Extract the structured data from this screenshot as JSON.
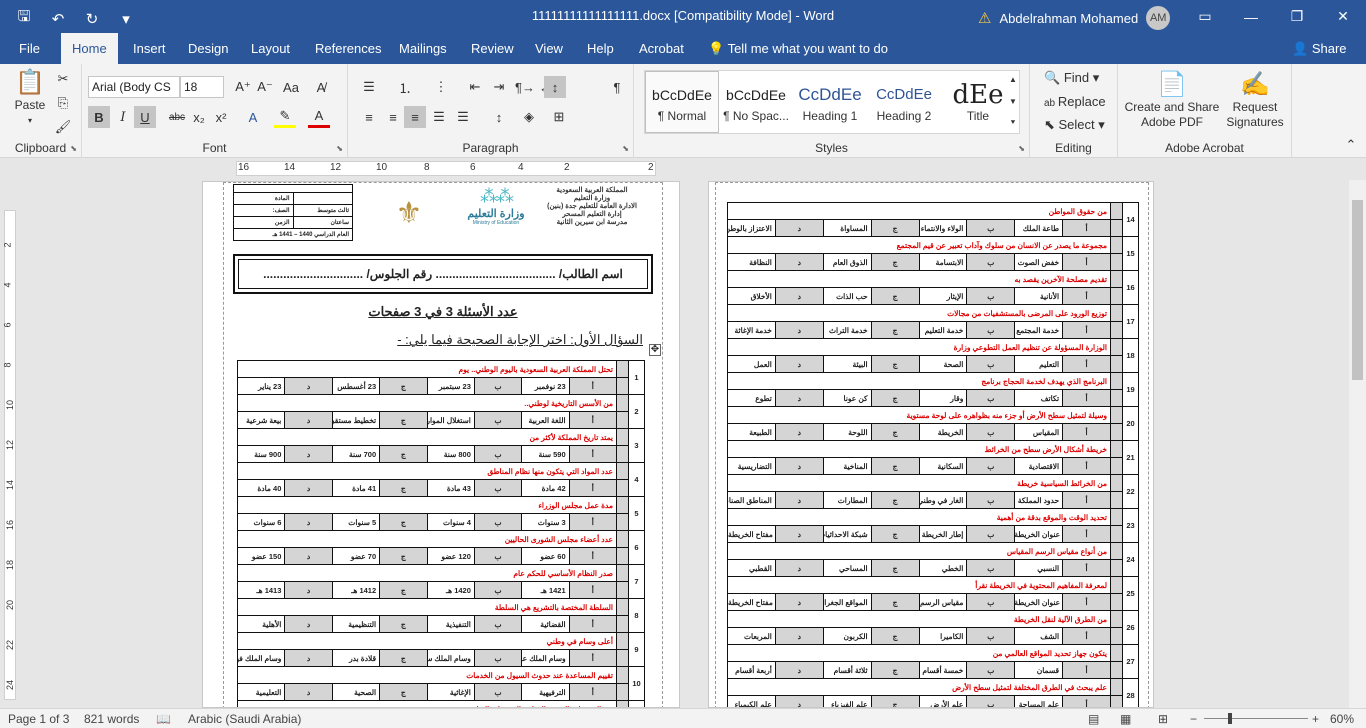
{
  "app": {
    "doc_title": "11111111111111111.docx [Compatibility Mode]  -  Word",
    "user_name": "Abdelrahman Mohamed",
    "user_initials": "AM"
  },
  "tabs": [
    "File",
    "Home",
    "Insert",
    "Design",
    "Layout",
    "References",
    "Mailings",
    "Review",
    "View",
    "Help",
    "Acrobat"
  ],
  "tell_me": "Tell me what you want to do",
  "share": "Share",
  "clipboard": {
    "paste": "Paste",
    "label": "Clipboard"
  },
  "font": {
    "name": "Arial (Body CS",
    "size": "18",
    "label": "Font"
  },
  "paragraph": {
    "label": "Paragraph"
  },
  "styles": {
    "label": "Styles",
    "items": [
      {
        "preview": "bCcDdEe",
        "name": "¶ Normal"
      },
      {
        "preview": "bCcDdEe",
        "name": "¶ No Spac..."
      },
      {
        "preview": "CcDdEe",
        "name": "Heading 1"
      },
      {
        "preview": "CcDdEe",
        "name": "Heading 2"
      },
      {
        "preview": "dEe",
        "name": "Title"
      }
    ]
  },
  "editing": {
    "find": "Find",
    "replace": "Replace",
    "select": "Select",
    "label": "Editing"
  },
  "acrobat": {
    "create": "Create and Share Adobe PDF",
    "request": "Request Signatures",
    "label": "Adobe Acrobat"
  },
  "ruler": [
    "16",
    "14",
    "12",
    "10",
    "8",
    "6",
    "4",
    "2",
    "2"
  ],
  "vruler": [
    "2",
    "4",
    "6",
    "8",
    "10",
    "12",
    "14",
    "16",
    "18",
    "20",
    "22",
    "24"
  ],
  "status": {
    "page": "Page 1 of 3",
    "words": "821 words",
    "language": "Arabic (Saudi Arabia)",
    "zoom": "60%"
  },
  "left_page": {
    "header_right": [
      "المملكة العربية السعودية",
      "وزارة التعليم",
      "الادارة العامة للتعليم جدة (بنين)",
      "إدارة التعليم المسحر",
      "مدرسة ابن سيرين الثانية"
    ],
    "ministry": "وزارة التعليم",
    "ministry_en": "Ministry of Education",
    "info": [
      [
        "المادة",
        ""
      ],
      [
        "الصف:",
        "ثالث متوسط"
      ],
      [
        "الزمن",
        "ساعتان"
      ],
      [
        "العام الدراسي 1440 – 1441 هـ",
        ""
      ]
    ],
    "student_line": "اسم الطالب/ ....................................  رقم الجلوس/ ..............................",
    "count_line": "عدد الأسئلة 3 في 3 صفحات",
    "q1_title": "السؤال الأول: اختر الإجابة الصحيحة فيما يلي: -",
    "letters": [
      "أ",
      "ب",
      "ج",
      "د"
    ],
    "questions": [
      {
        "n": "1",
        "q": "تحتل المملكة العربية السعودية باليوم الوطني.. يوم",
        "o": [
          "23 نوفمبر",
          "23 سبتمبر",
          "23 أغسطس",
          "23 يناير"
        ]
      },
      {
        "n": "2",
        "q": "من الأسس التاريخية لوطني..",
        "o": [
          "اللغة العربية",
          "استغلال الموارد",
          "تخطيط مستقبلي",
          "بيعة شرعية"
        ]
      },
      {
        "n": "3",
        "q": "يمتد تاريخ المملكة لأكثر من",
        "o": [
          "590 سنة",
          "800 سنة",
          "700 سنة",
          "900 سنة"
        ]
      },
      {
        "n": "4",
        "q": "عدد المواد التي يتكون منها نظام المناطق",
        "o": [
          "42 مادة",
          "43 مادة",
          "41 مادة",
          "40 مادة"
        ]
      },
      {
        "n": "5",
        "q": "مدة عمل مجلس الوزراء",
        "o": [
          "3 سنوات",
          "4 سنوات",
          "5 سنوات",
          "6 سنوات"
        ]
      },
      {
        "n": "6",
        "q": "عدد أعضاء مجلس الشورى الحاليين",
        "o": [
          "60 عضو",
          "120 عضو",
          "70 عضو",
          "150 عضو"
        ]
      },
      {
        "n": "7",
        "q": "صدر النظام الأساسي للحكم عام",
        "o": [
          "1421 هـ",
          "1420 هـ",
          "1412 هـ",
          "1413 هـ"
        ]
      },
      {
        "n": "8",
        "q": "السلطة المختصة بالتشريع هي السلطة",
        "o": [
          "القضائية",
          "التنفيذية",
          "التنظيمية",
          "الأهلية"
        ]
      },
      {
        "n": "9",
        "q": "أعلى وسام في وطني",
        "o": [
          "وسام الملك عبد العزيز",
          "وسام الملك سلمان",
          "قلادة بدر",
          "وسام الملك فيصل"
        ]
      },
      {
        "n": "10",
        "q": "تقييم المساعدة عند حدوث السيول من الخدمات",
        "o": [
          "الترفيهية",
          "الإغاثية",
          "الصحية",
          "التعليمية"
        ]
      },
      {
        "n": "11",
        "q": "من المقومات الحيوية الوطنية المرتبطة بالثقافة",
        "o": [
          "",
          "",
          "",
          ""
        ]
      }
    ]
  },
  "right_page": {
    "questions": [
      {
        "n": "14",
        "q": "من حقوق المواطن",
        "o": [
          "طاعة الملك",
          "الولاء والانتماء",
          "المساواة",
          "الاعتزاز بالوطن"
        ]
      },
      {
        "n": "15",
        "q": "مجموعة ما يصدر عن الانسان من سلوك وآداب تعبير عن قيم المجتمع",
        "o": [
          "خفض الصوت",
          "الابتسامة",
          "الذوق العام",
          "النظافة"
        ]
      },
      {
        "n": "16",
        "q": "تقديم مصلحة الآخرين يقصد به",
        "o": [
          "الأنانية",
          "الإيثار",
          "حب الذات",
          "الأخلاق"
        ]
      },
      {
        "n": "17",
        "q": "توزيع الورود على المرضى بالمستشفيات من مجالات",
        "o": [
          "خدمة المجتمع",
          "خدمة التعليم",
          "خدمة التراث",
          "خدمة الإغاثة"
        ]
      },
      {
        "n": "18",
        "q": "الوزارة المسؤولة عن تنظيم العمل التطوعي وزارة",
        "o": [
          "التعليم",
          "الصحة",
          "البيئة",
          "العمل"
        ]
      },
      {
        "n": "19",
        "q": "البرنامج الذي يهدف لخدمة الحجاج برنامج",
        "o": [
          "تكاتف",
          "وقار",
          "كن عونا",
          "تطوع"
        ]
      },
      {
        "n": "20",
        "q": "وسيلة لتمثيل سطح الأرض أو جزء منه بظواهره على لوحة مستوية",
        "o": [
          "المقياس",
          "الخريطة",
          "اللوحة",
          "الطبيعة"
        ]
      },
      {
        "n": "21",
        "q": "خريطة أشكال الأرض سطح من الخرائط",
        "o": [
          "الاقتصادية",
          "السكانية",
          "المناخية",
          "التضاريسية"
        ]
      },
      {
        "n": "22",
        "q": "من الخرائط السياسية خريطة",
        "o": [
          "حدود المملكة",
          "الغار في وطني",
          "المطارات",
          "المناطق الصناعية"
        ]
      },
      {
        "n": "23",
        "q": "تحديد الوقت والموقع بدقة من أهمية",
        "o": [
          "عنوان الخريطة",
          "إطار الخريطة",
          "شبكة الاحداثيات",
          "مفتاح الخريطة"
        ]
      },
      {
        "n": "24",
        "q": "من أنواع مقياس الرسم المقياس",
        "o": [
          "النسبي",
          "الخطي",
          "المساحي",
          "القطبي"
        ]
      },
      {
        "n": "25",
        "q": "لمعرفة المفاهيم المحتوية في الخريطة نقرأ",
        "o": [
          "عنوان الخريطة",
          "مقياس الرسم",
          "المواقع الجغرافية",
          "مفتاح الخريطة"
        ]
      },
      {
        "n": "26",
        "q": "من الطرق الآلية لنقل الخريطة",
        "o": [
          "الشف",
          "الكاميرا",
          "الكربون",
          "المربعات"
        ]
      },
      {
        "n": "27",
        "q": "يتكون جهاز تحديد المواقع العالمي من",
        "o": [
          "قسمان",
          "خمسة أقسام",
          "ثلاثة أقسام",
          "أربعة أقسام"
        ]
      },
      {
        "n": "28",
        "q": "علم يبحث في الطرق المختلفة لتمثيل سطح الأرض",
        "o": [
          "علم المساحة",
          "علم الأرض",
          "علم الفيزياء",
          "علم الكيمياء"
        ]
      }
    ]
  }
}
